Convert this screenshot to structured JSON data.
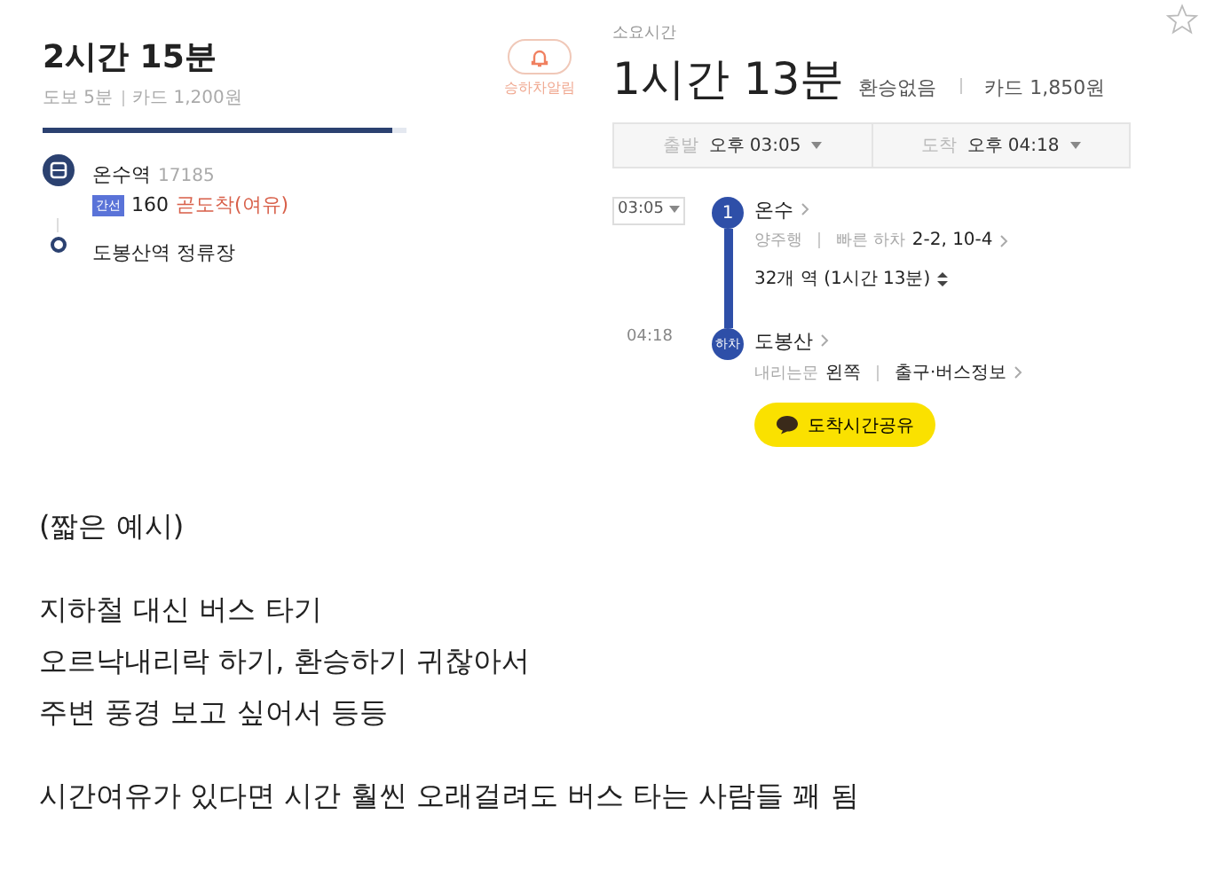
{
  "route_a": {
    "duration": "2시간 15분",
    "walk": "도보 5분",
    "fare": "카드 1,200원",
    "alarm": "승하차알림",
    "progress": {
      "level": 0.96
    },
    "stops": [
      {
        "kind": "bus",
        "name": "온수역",
        "code": "17185",
        "badge": "간선",
        "route": "160",
        "status": "곧도착(여유)"
      },
      {
        "kind": "end",
        "name": "도봉산역 정류장"
      }
    ]
  },
  "route_b": {
    "label": "소요시간",
    "duration": "1시간 13분",
    "transfer": "환승없음",
    "fare": "카드 1,850원",
    "times": [
      {
        "label": "출발",
        "value": "오후 03:05"
      },
      {
        "label": "도착",
        "value": "오후 04:18"
      }
    ],
    "start": {
      "time": "03:05",
      "marker": "1",
      "name": "온수",
      "direction": "양주행",
      "fast_label": "빠른 하차",
      "fast_value": "2-2, 10-4",
      "stations": "32개 역 (1시간 13분)"
    },
    "end": {
      "time": "04:18",
      "marker": "하차",
      "name": "도봉산",
      "door_label": "내리는문",
      "door_value": "왼쪽",
      "exit": "출구·버스정보"
    },
    "share": "도착시간공유"
  },
  "body": [
    {
      "kind": "note",
      "text": "(짧은 예시)"
    },
    {
      "kind": "group",
      "lines": [
        "지하철 대신 버스 타기",
        "오르낙내리락 하기, 환승하기 귀찮아서",
        "주변 풍경 보고 싶어서 등등"
      ]
    },
    {
      "kind": "group",
      "lines": [
        "시간여유가 있다면 시간 훨씬 오래걸려도 버스 타는 사람들 꽤 됨"
      ]
    }
  ]
}
